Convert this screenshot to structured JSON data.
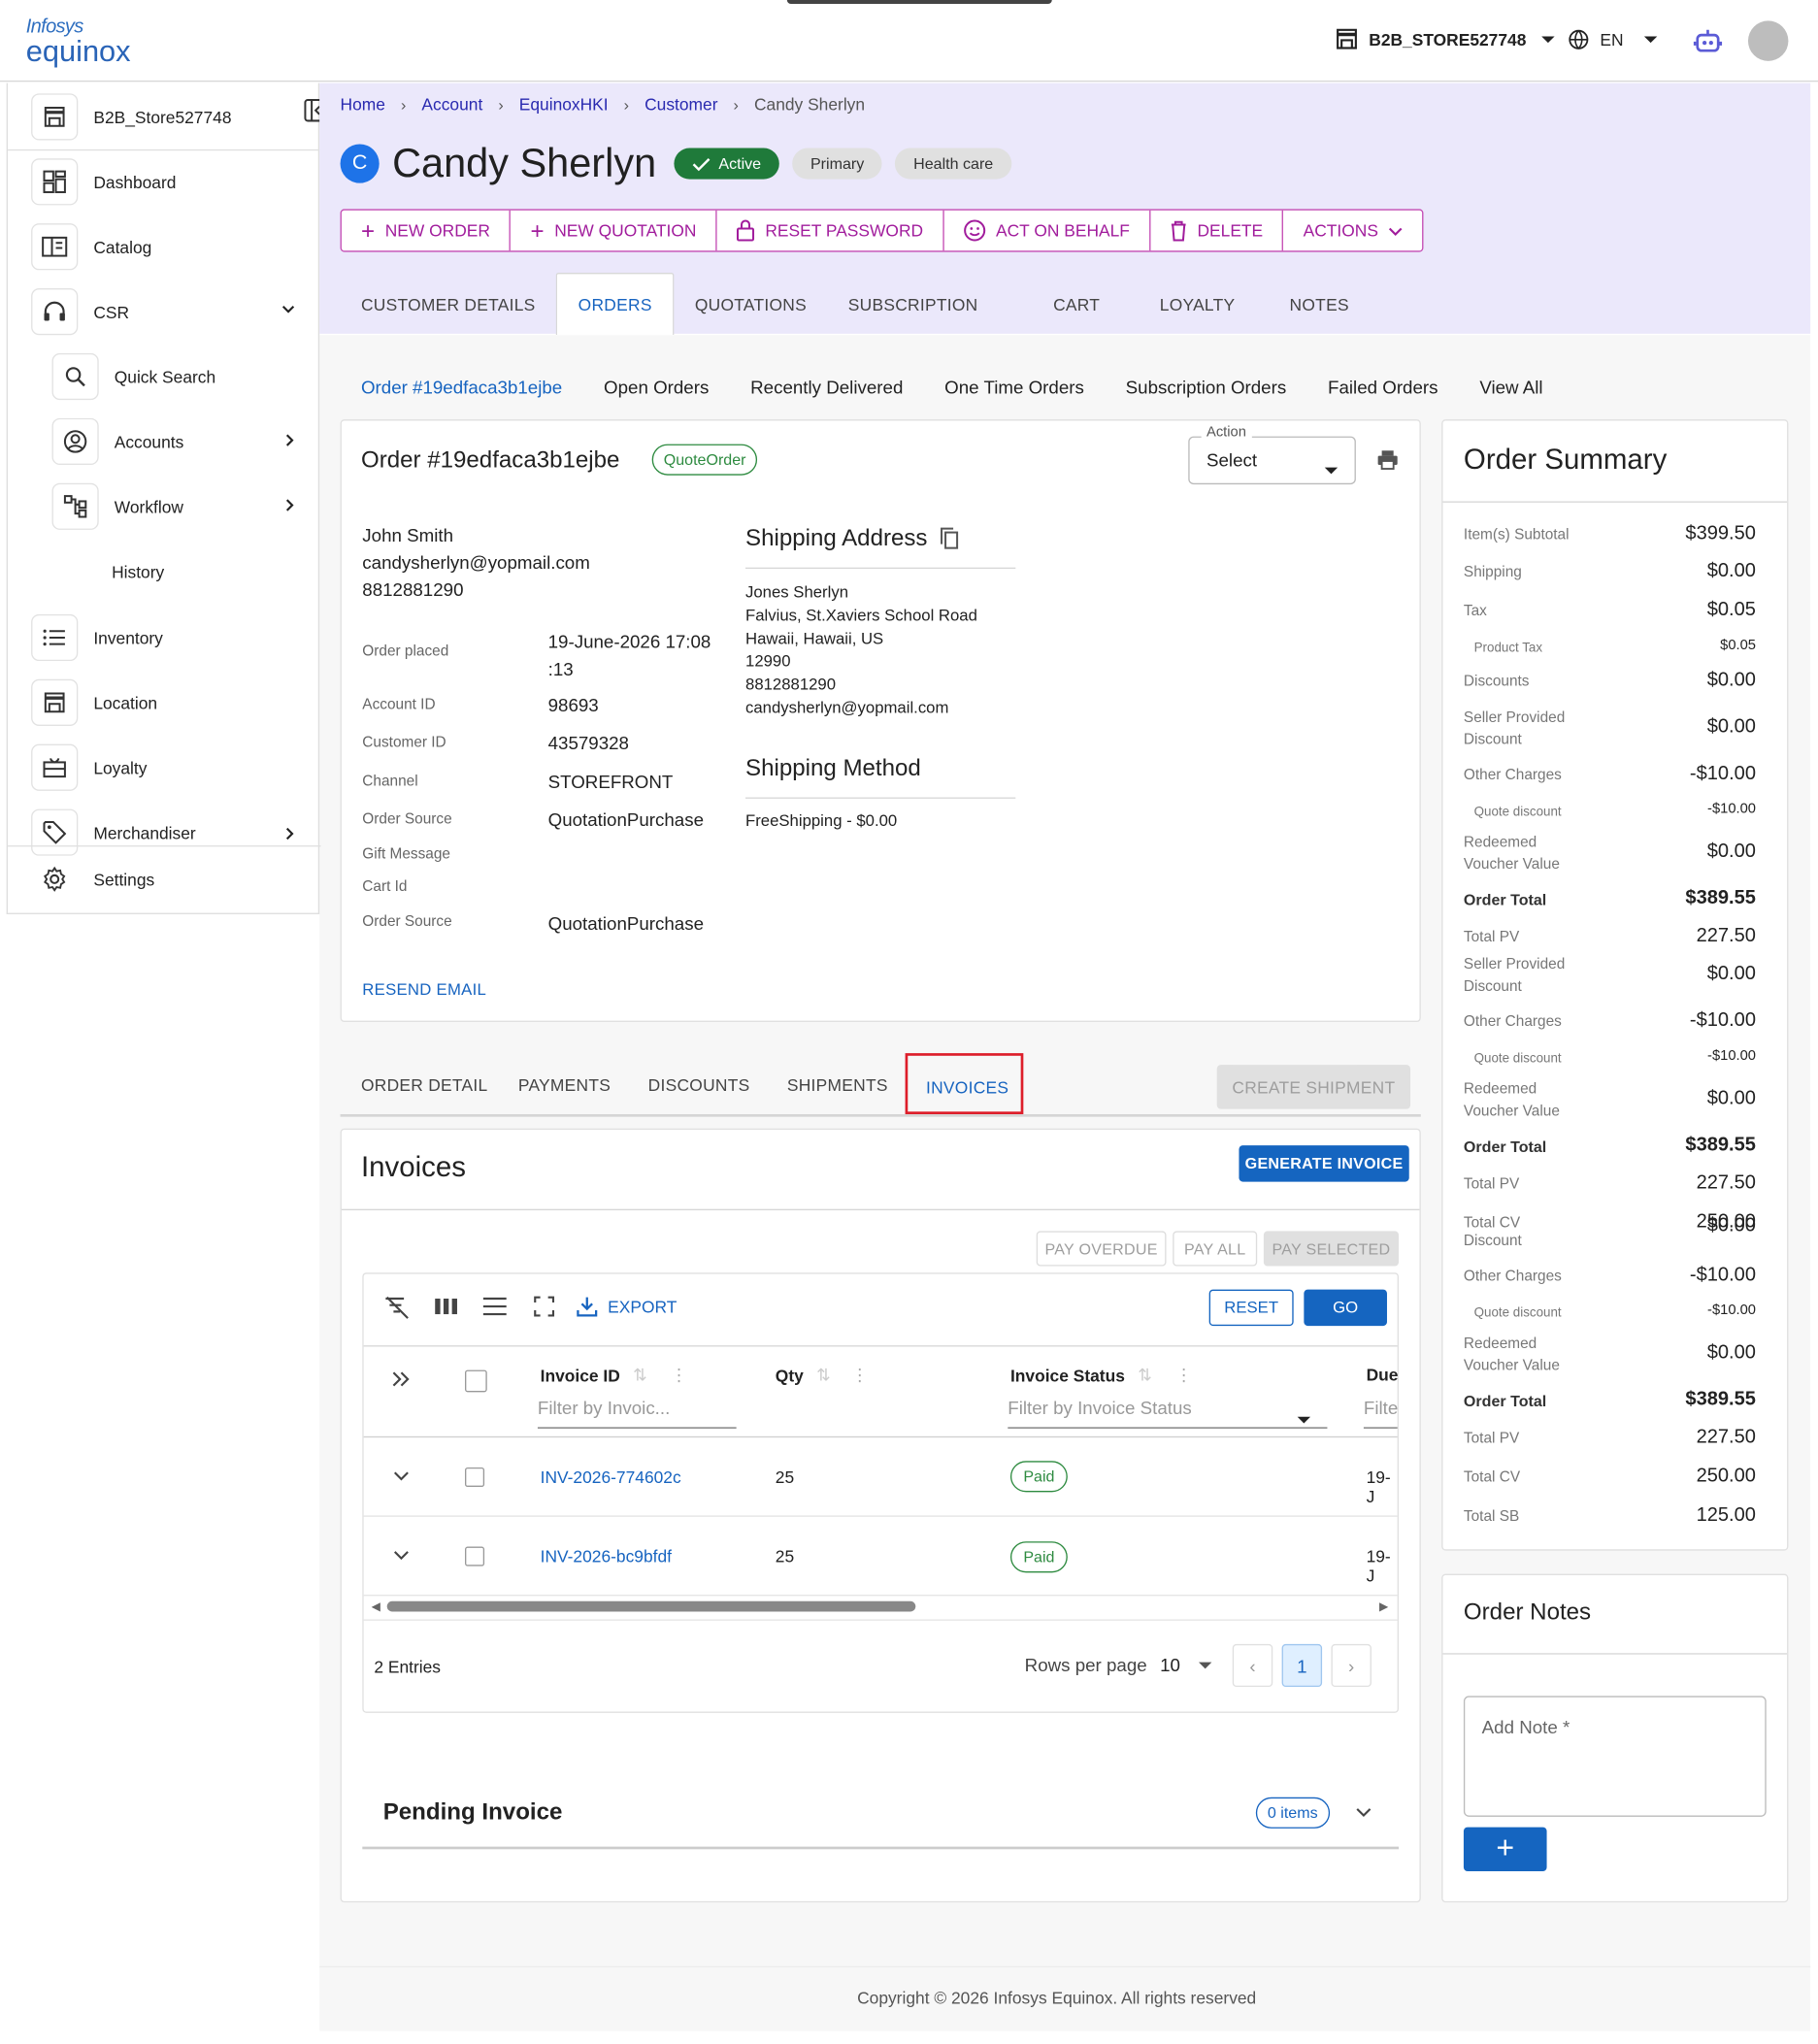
{
  "app": {
    "logo_top": "Infosys",
    "logo_bottom": "equinox"
  },
  "topbar": {
    "store": "B2B_STORE527748",
    "lang": "EN"
  },
  "sidebar": {
    "store": "B2B_Store527748",
    "items": [
      {
        "label": "Dashboard"
      },
      {
        "label": "Catalog"
      },
      {
        "label": "CSR"
      },
      {
        "label": "Quick Search"
      },
      {
        "label": "Accounts"
      },
      {
        "label": "Workflow"
      },
      {
        "label": "History"
      },
      {
        "label": "Inventory"
      },
      {
        "label": "Location"
      },
      {
        "label": "Loyalty"
      },
      {
        "label": "Merchandiser"
      },
      {
        "label": "Settings"
      }
    ]
  },
  "breadcrumb": [
    "Home",
    "Account",
    "EquinoxHKI",
    "Customer",
    "Candy Sherlyn"
  ],
  "customer": {
    "initial": "C",
    "name": "Candy Sherlyn",
    "status": "Active",
    "tags": [
      "Primary",
      "Health care"
    ]
  },
  "actions": [
    "NEW ORDER",
    "NEW QUOTATION",
    "RESET PASSWORD",
    "ACT ON BEHALF",
    "DELETE",
    "ACTIONS"
  ],
  "tabs": [
    "CUSTOMER DETAILS",
    "ORDERS",
    "QUOTATIONS",
    "SUBSCRIPTION",
    "CART",
    "LOYALTY",
    "NOTES"
  ],
  "order_tabs": [
    "Order #19edfaca3b1ejbe",
    "Open Orders",
    "Recently Delivered",
    "One Time Orders",
    "Subscription Orders",
    "Failed Orders",
    "View All"
  ],
  "order": {
    "title": "Order #19edfaca3b1ejbe",
    "type": "QuoteOrder",
    "action_label": "Action",
    "action_value": "Select",
    "contact_name": "John Smith",
    "contact_email": "candysherlyn@yopmail.com",
    "contact_phone": "8812881290",
    "fields": [
      {
        "label": "Order placed",
        "value": "19-June-2026 17:08 :13"
      },
      {
        "label": "Account ID",
        "value": "98693"
      },
      {
        "label": "Customer ID",
        "value": "43579328"
      },
      {
        "label": "Channel",
        "value": "STOREFRONT"
      },
      {
        "label": "Order Source",
        "value": "QuotationPurchase"
      },
      {
        "label": "Gift Message",
        "value": ""
      },
      {
        "label": "Cart Id",
        "value": ""
      },
      {
        "label": "Order Source",
        "value": "QuotationPurchase"
      }
    ],
    "shipping_address_title": "Shipping Address",
    "address_lines": [
      "Jones Sherlyn",
      "Falvius, St.Xaviers School Road",
      "Hawaii, Hawaii, US",
      "12990",
      "8812881290",
      "candysherlyn@yopmail.com"
    ],
    "shipping_method_title": "Shipping Method",
    "shipping_method": "FreeShipping - $0.00",
    "resend": "RESEND EMAIL"
  },
  "detail_tabs": [
    "ORDER DETAIL",
    "PAYMENTS",
    "DISCOUNTS",
    "SHIPMENTS",
    "INVOICES"
  ],
  "create_shipment": "CREATE SHIPMENT",
  "invoices": {
    "title": "Invoices",
    "generate": "GENERATE INVOICE",
    "pay_overdue": "PAY OVERDUE",
    "pay_all": "PAY ALL",
    "pay_selected": "PAY SELECTED",
    "export": "EXPORT",
    "reset": "RESET",
    "go": "GO",
    "columns": {
      "id": "Invoice ID",
      "qty": "Qty",
      "status": "Invoice Status",
      "due": "Due"
    },
    "filters": {
      "id": "Filter by Invoic...",
      "status": "Filter by Invoice Status",
      "due": "Filte"
    },
    "rows": [
      {
        "id": "INV-2026-774602c",
        "qty": "25",
        "status": "Paid",
        "due": "19-J"
      },
      {
        "id": "INV-2026-bc9bfdf",
        "qty": "25",
        "status": "Paid",
        "due": "19-J"
      }
    ],
    "entries": "2 Entries",
    "rows_per_page_label": "Rows per page",
    "rows_per_page": "10",
    "page": "1",
    "pending_title": "Pending Invoice",
    "pending_count": "0 items"
  },
  "summary": {
    "title": "Order Summary",
    "lines": [
      {
        "label": "Item(s) Subtotal",
        "value": "$399.50"
      },
      {
        "label": "Shipping",
        "value": "$0.00"
      },
      {
        "label": "Tax",
        "value": "$0.05"
      },
      {
        "label": "Product Tax",
        "value": "$0.05",
        "small": true
      },
      {
        "label": "Discounts",
        "value": "$0.00"
      },
      {
        "label": "Seller Provided Discount",
        "value": "$0.00"
      },
      {
        "label": "Other Charges",
        "value": "-$10.00"
      },
      {
        "label": "Quote discount",
        "value": "-$10.00",
        "small": true
      },
      {
        "label": "Redeemed Voucher Value",
        "value": "$0.00"
      },
      {
        "label": "Order Total",
        "value": "$389.55",
        "bold": true
      },
      {
        "label": "Total PV",
        "value": "227.50"
      },
      {
        "label": "Seller Provided Discount",
        "value": "$0.00"
      },
      {
        "label": "Other Charges",
        "value": "-$10.00"
      },
      {
        "label": "Quote discount",
        "value": "-$10.00",
        "small": true
      },
      {
        "label": "Redeemed Voucher Value",
        "value": "$0.00"
      },
      {
        "label": "Order Total",
        "value": "$389.55",
        "bold": true
      },
      {
        "label": "Total PV",
        "value": "227.50"
      },
      {
        "label": "Total CV",
        "value": "250.00"
      },
      {
        "label": "Discount",
        "value": "$0.00"
      },
      {
        "label": "Other Charges",
        "value": "-$10.00"
      },
      {
        "label": "Quote discount",
        "value": "-$10.00",
        "small": true
      },
      {
        "label": "Redeemed Voucher Value",
        "value": "$0.00"
      },
      {
        "label": "Order Total",
        "value": "$389.55",
        "bold": true
      },
      {
        "label": "Total PV",
        "value": "227.50"
      },
      {
        "label": "Total CV",
        "value": "250.00"
      },
      {
        "label": "Total SB",
        "value": "125.00"
      }
    ]
  },
  "notes": {
    "title": "Order Notes",
    "placeholder": "Add Note *",
    "add": "+"
  },
  "footer": "Copyright © 2026 Infosys Equinox. All rights reserved",
  "colors": {
    "accent": "#1565c0",
    "brand_purple": "#a11c9c",
    "active_green": "#1f7a3a",
    "highlight_red": "#dd1e2a"
  }
}
